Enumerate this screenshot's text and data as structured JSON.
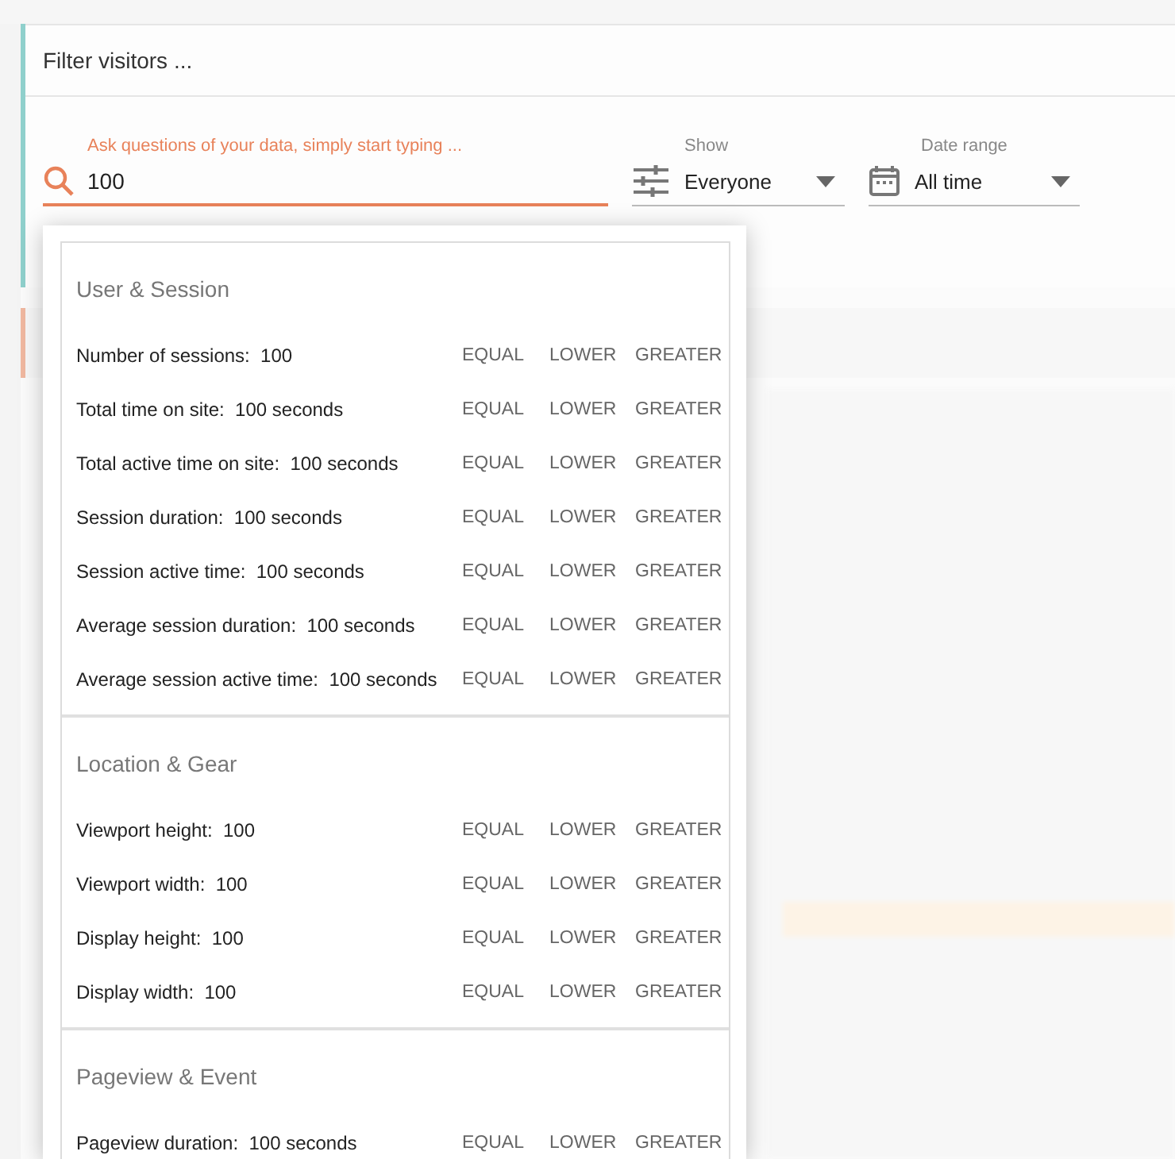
{
  "filter_bar": {
    "title": "Filter visitors ..."
  },
  "search": {
    "label": "Ask questions of your data, simply start typing ...",
    "value": "100"
  },
  "show": {
    "label": "Show",
    "value": "Everyone"
  },
  "date_range": {
    "label": "Date range",
    "value": "All time"
  },
  "suggestions": [
    {
      "title": "User & Session",
      "items": [
        {
          "field": "Number of sessions:",
          "value": "100",
          "operators": [
            "EQUAL",
            "LOWER",
            "GREATER"
          ]
        },
        {
          "field": "Total time on site:",
          "value": "100 seconds",
          "operators": [
            "EQUAL",
            "LOWER",
            "GREATER"
          ]
        },
        {
          "field": "Total active time on site:",
          "value": "100 seconds",
          "operators": [
            "EQUAL",
            "LOWER",
            "GREATER"
          ]
        },
        {
          "field": "Session duration:",
          "value": "100 seconds",
          "operators": [
            "EQUAL",
            "LOWER",
            "GREATER"
          ]
        },
        {
          "field": "Session active time:",
          "value": "100 seconds",
          "operators": [
            "EQUAL",
            "LOWER",
            "GREATER"
          ]
        },
        {
          "field": "Average session duration:",
          "value": "100 seconds",
          "operators": [
            "EQUAL",
            "LOWER",
            "GREATER"
          ]
        },
        {
          "field": "Average session active time:",
          "value": "100 seconds",
          "operators": [
            "EQUAL",
            "LOWER",
            "GREATER"
          ]
        }
      ]
    },
    {
      "title": "Location & Gear",
      "items": [
        {
          "field": "Viewport height:",
          "value": "100",
          "operators": [
            "EQUAL",
            "LOWER",
            "GREATER"
          ]
        },
        {
          "field": "Viewport width:",
          "value": "100",
          "operators": [
            "EQUAL",
            "LOWER",
            "GREATER"
          ]
        },
        {
          "field": "Display height:",
          "value": "100",
          "operators": [
            "EQUAL",
            "LOWER",
            "GREATER"
          ]
        },
        {
          "field": "Display width:",
          "value": "100",
          "operators": [
            "EQUAL",
            "LOWER",
            "GREATER"
          ]
        }
      ]
    },
    {
      "title": "Pageview & Event",
      "items": [
        {
          "field": "Pageview duration:",
          "value": "100 seconds",
          "operators": [
            "EQUAL",
            "LOWER",
            "GREATER"
          ]
        }
      ]
    }
  ]
}
